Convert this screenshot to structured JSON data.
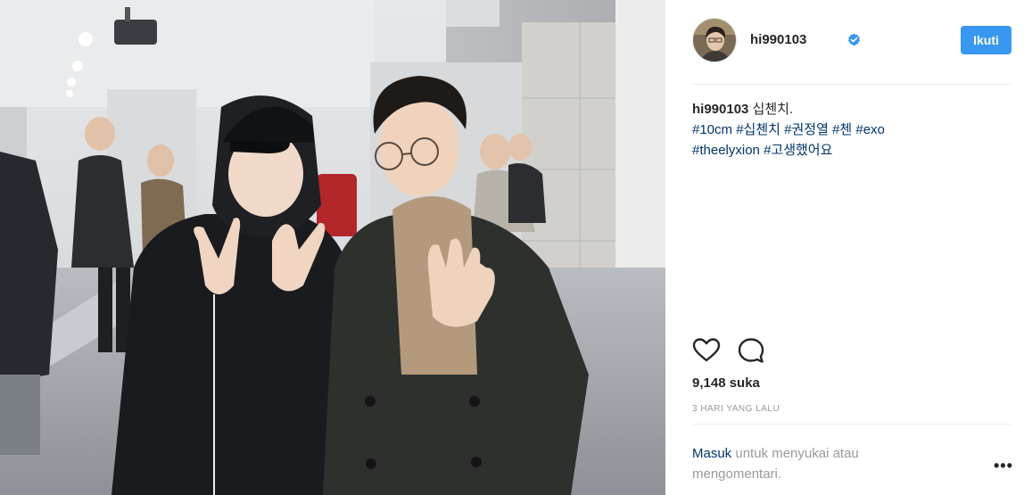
{
  "post": {
    "username": "hi990103",
    "follow_label": "Ikuti",
    "caption": {
      "username": "hi990103",
      "text": " 십첸치.",
      "line2": [
        "#10cm",
        "#십첸치",
        "#권정열",
        "#첸",
        "#exo"
      ],
      "line3": [
        "#theelyxion",
        "#고생했어요"
      ]
    },
    "likes": "9,148 suka",
    "time_ago": "3 HARI YANG LALU",
    "login_link": "Masuk",
    "login_text": " untuk menyukai atau mengomentari.",
    "more_label": "•••"
  },
  "colors": {
    "accent": "#3897f0",
    "hashtag": "#003569",
    "muted": "#999999",
    "text": "#262626"
  },
  "icons": {
    "verified": "verified-badge-icon",
    "like": "heart-outline-icon",
    "comment": "speech-bubble-icon",
    "more": "ellipsis-icon"
  }
}
